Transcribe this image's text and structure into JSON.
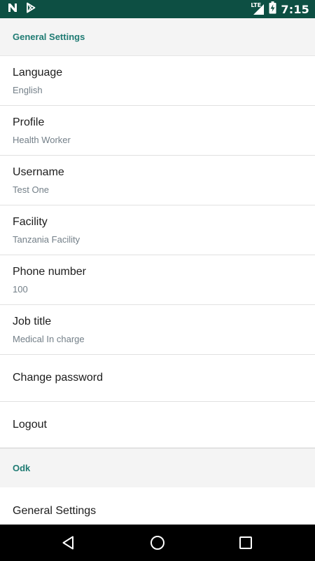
{
  "status_bar": {
    "time": "7:15",
    "network_label": "LTE",
    "icons": [
      "n-notification-icon",
      "play-store-icon",
      "lte-signal-icon",
      "battery-charging-icon"
    ],
    "background_color": "#0d4f43"
  },
  "sections": {
    "general": {
      "header": "General Settings",
      "items": [
        {
          "title": "Language",
          "summary": "English"
        },
        {
          "title": "Profile",
          "summary": "Health Worker"
        },
        {
          "title": "Username",
          "summary": "Test One"
        },
        {
          "title": "Facility",
          "summary": "Tanzania Facility"
        },
        {
          "title": "Phone number",
          "summary": "100"
        },
        {
          "title": "Job title",
          "summary": "Medical In charge"
        }
      ],
      "change_password": "Change password",
      "logout": "Logout"
    },
    "odk": {
      "header": "Odk",
      "first_item": "General Settings"
    }
  },
  "colors": {
    "accent": "#1f7b73",
    "section_bg": "#f4f4f4",
    "summary_text": "#737f88"
  },
  "nav_bar": {
    "icons": [
      "back-triangle-icon",
      "home-circle-icon",
      "recents-square-icon"
    ]
  }
}
